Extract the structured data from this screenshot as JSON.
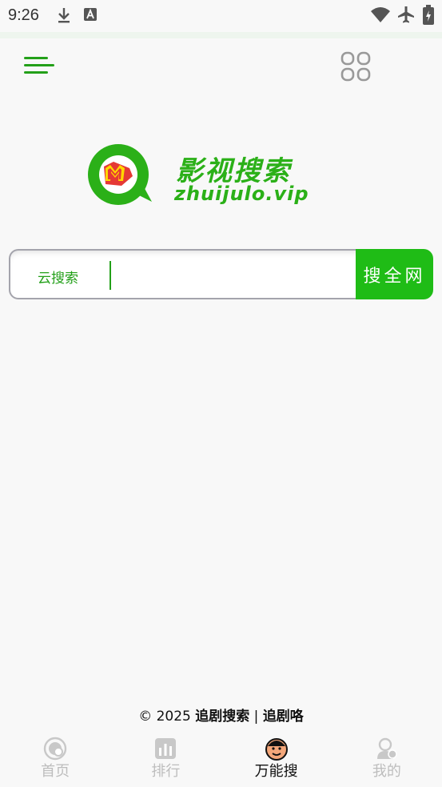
{
  "status_bar": {
    "time": "9:26",
    "icons": [
      "download-icon",
      "text-a-icon",
      "wifi-icon",
      "airplane-icon",
      "battery-charging-icon"
    ]
  },
  "app_bar": {
    "menu_icon": "menu-icon",
    "grid_icon": "grid-icon"
  },
  "logo": {
    "title_cn": "影视搜索",
    "domain": "zhuijulo.vip",
    "colors": {
      "green": "#2bb018",
      "red": "#e53935",
      "yellow": "#ffd600"
    }
  },
  "search": {
    "engine_label": "云搜索",
    "placeholder": "",
    "value": "",
    "button_label": "搜全网",
    "accent": "#1fbc16"
  },
  "footer": {
    "prefix": "© 2025 ",
    "site_name": "追剧搜索",
    "separator": " | ",
    "site_name2": "追剧咯"
  },
  "bottom_nav": {
    "items": [
      {
        "label": "首页",
        "icon": "home-icon",
        "active": false
      },
      {
        "label": "排行",
        "icon": "ranking-icon",
        "active": false
      },
      {
        "label": "万能搜",
        "icon": "search-face-icon",
        "active": true
      },
      {
        "label": "我的",
        "icon": "profile-icon",
        "active": false
      }
    ]
  }
}
